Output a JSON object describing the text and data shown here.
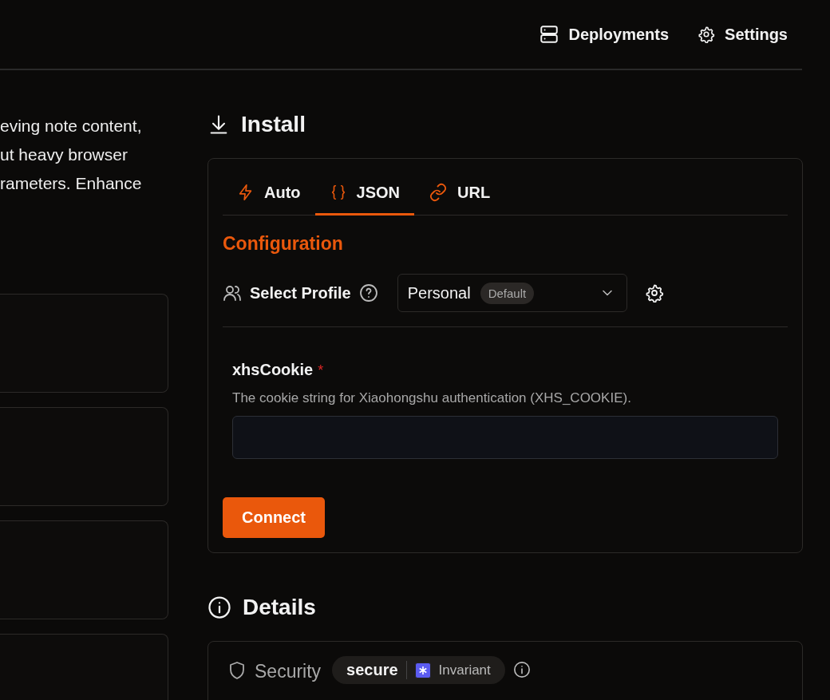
{
  "nav": [
    {
      "kind": "deployments",
      "label": "Deployments"
    },
    {
      "kind": "settings",
      "label": "Settings"
    }
  ],
  "description_lines": [
    "eving note content,",
    "ut heavy browser",
    "rameters. Enhance"
  ],
  "install": {
    "title": "Install",
    "tabs": [
      {
        "kind": "bolt",
        "label": "Auto",
        "selected": false
      },
      {
        "kind": "braces",
        "label": "JSON",
        "selected": true
      },
      {
        "kind": "link",
        "label": "URL",
        "selected": false
      }
    ],
    "section_title": "Configuration",
    "profile": {
      "label": "Select Profile",
      "value": "Personal",
      "badge": "Default"
    },
    "field": {
      "label": "xhsCookie",
      "required": "*",
      "description": "The cookie string for Xiaohongshu authentication (XHS_COOKIE)."
    },
    "button": "Connect"
  },
  "details": {
    "title": "Details",
    "security": {
      "label": "Security",
      "status": "secure",
      "provider": "Invariant"
    }
  }
}
